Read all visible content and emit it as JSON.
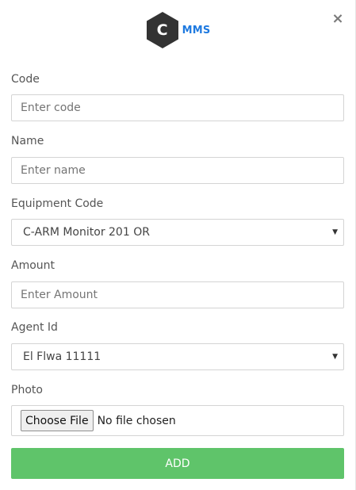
{
  "header": {
    "logo_letter": "C",
    "brand": "MMS",
    "close_glyph": "×",
    "logo_color": "#333333",
    "brand_color": "#1f7ae0"
  },
  "form": {
    "code": {
      "label": "Code",
      "placeholder": "Enter code",
      "value": ""
    },
    "name": {
      "label": "Name",
      "placeholder": "Enter name",
      "value": ""
    },
    "equipment_code": {
      "label": "Equipment Code",
      "selected": "C-ARM Monitor 201 OR"
    },
    "amount": {
      "label": "Amount",
      "placeholder": "Enter Amount",
      "value": ""
    },
    "agent_id": {
      "label": "Agent Id",
      "selected": "El Flwa 11111"
    },
    "photo": {
      "label": "Photo",
      "button": "Choose File",
      "status": "No file chosen"
    },
    "submit": {
      "label": "ADD",
      "color": "#5fc46a"
    }
  },
  "icons": {
    "close": "close-icon",
    "caret": "chevron-down-icon",
    "logo": "hexagon-logo-icon"
  }
}
